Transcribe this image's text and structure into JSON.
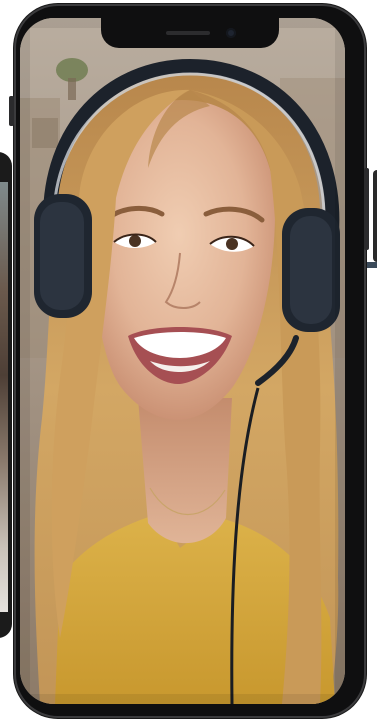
{
  "device": {
    "type": "smartphone",
    "orientation": "portrait"
  },
  "screen": {
    "content": "video-call-photo"
  },
  "colors": {
    "frame": "#0f0f10",
    "hair": "#c99a58",
    "skin": "#e2b79a",
    "shirt": "#d8ad42",
    "headphones": "#1f2630",
    "background": "#b8ab9c"
  },
  "icons": [
    "notch-speaker-icon",
    "front-camera-icon"
  ]
}
